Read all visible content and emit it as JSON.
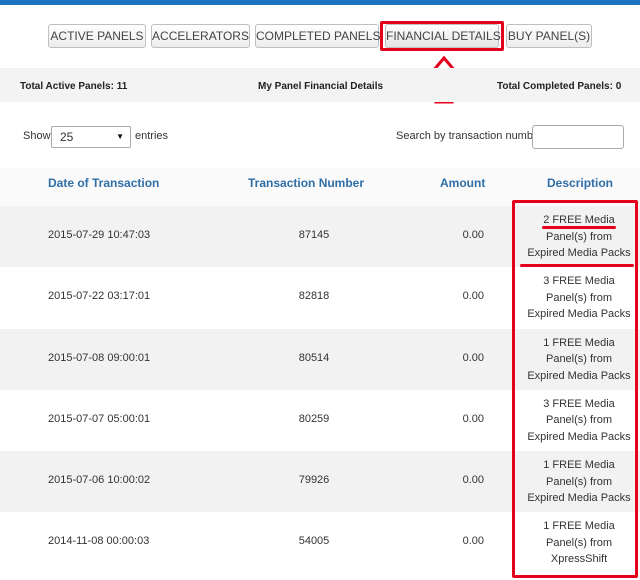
{
  "tabs": [
    {
      "label": "ACTIVE PANELS"
    },
    {
      "label": "ACCELERATORS"
    },
    {
      "label": "COMPLETED PANELS"
    },
    {
      "label": "FINANCIAL DETAILS"
    },
    {
      "label": "BUY PANEL(S)"
    }
  ],
  "summary": {
    "active_panels": "Total Active Panels: 11",
    "title": "My Panel Financial Details",
    "completed_panels": "Total Completed Panels: 0"
  },
  "controls": {
    "show_label": "Show",
    "page_size": "25",
    "entries_label": "entries",
    "search_label": "Search by transaction number:",
    "search_value": ""
  },
  "table": {
    "headers": {
      "date": "Date of Transaction",
      "number": "Transaction Number",
      "amount": "Amount",
      "description": "Description"
    },
    "rows": [
      {
        "date": "2015-07-29 10:47:03",
        "number": "87145",
        "amount": "0.00",
        "desc1": "2 FREE Media",
        "desc2": "Panel(s) from",
        "desc3": "Expired Media Packs"
      },
      {
        "date": "2015-07-22 03:17:01",
        "number": "82818",
        "amount": "0.00",
        "desc1": "3 FREE Media",
        "desc2": "Panel(s) from",
        "desc3": "Expired Media Packs"
      },
      {
        "date": "2015-07-08 09:00:01",
        "number": "80514",
        "amount": "0.00",
        "desc1": "1 FREE Media",
        "desc2": "Panel(s) from",
        "desc3": "Expired Media Packs"
      },
      {
        "date": "2015-07-07 05:00:01",
        "number": "80259",
        "amount": "0.00",
        "desc1": "3 FREE Media",
        "desc2": "Panel(s) from",
        "desc3": "Expired Media Packs"
      },
      {
        "date": "2015-07-06 10:00:02",
        "number": "79926",
        "amount": "0.00",
        "desc1": "1 FREE Media",
        "desc2": "Panel(s) from",
        "desc3": "Expired Media Packs"
      },
      {
        "date": "2014-11-08 00:00:03",
        "number": "54005",
        "amount": "0.00",
        "desc1": "1 FREE Media",
        "desc2": "Panel(s) from",
        "desc3": "XpressShift"
      }
    ]
  },
  "colors": {
    "accent_blue": "#1e73be",
    "header_text": "#2f6fa7",
    "annotation_red": "#e5001c"
  }
}
